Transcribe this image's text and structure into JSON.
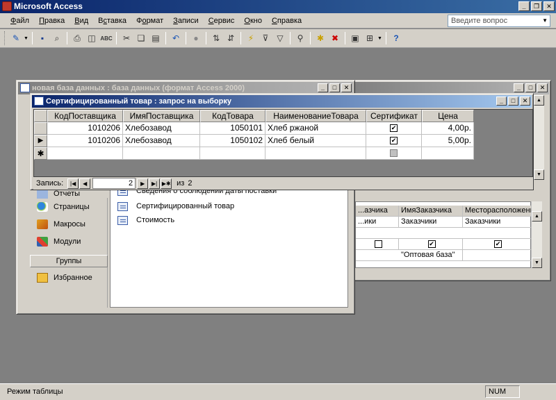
{
  "app": {
    "title": "Microsoft Access"
  },
  "menu": [
    {
      "label": "Файл",
      "acc": "Ф",
      "rest": "айл"
    },
    {
      "label": "Правка",
      "acc": "П",
      "rest": "равка"
    },
    {
      "label": "Вид",
      "acc": "В",
      "rest": "ид"
    },
    {
      "label": "Вставка",
      "acc": "с",
      "pre": "В",
      "rest": "тавка"
    },
    {
      "label": "Формат",
      "acc": "о",
      "pre": "Ф",
      "rest": "рмат"
    },
    {
      "label": "Записи",
      "acc": "З",
      "rest": "аписи"
    },
    {
      "label": "Сервис",
      "acc": "С",
      "rest": "ервис"
    },
    {
      "label": "Окно",
      "acc": "О",
      "rest": "кно"
    },
    {
      "label": "Справка",
      "acc": "С",
      "rest": "правка"
    }
  ],
  "help_box": {
    "placeholder": "Введите вопрос"
  },
  "db_window": {
    "title": "новая база данных : база данных (формат Access 2000)",
    "sidebar": {
      "pages": "Страницы",
      "macros": "Макросы",
      "modules": "Модули",
      "groups": "Группы",
      "favorites": "Избранное",
      "reports_partial": "Отчеты"
    },
    "list": {
      "partial": "Сведения о соблюдении даты поставки",
      "item1": "Сертифицированный товар",
      "item2": "Стоимость"
    }
  },
  "bg_table": {
    "headers": [
      "...азчика",
      "ИмяЗаказчика",
      "Месторасположение"
    ],
    "row1": [
      "...ики",
      "Заказчики",
      "Заказчики"
    ],
    "row4": [
      "",
      "\"Оптовая база\"",
      ""
    ]
  },
  "query_window": {
    "title": "Сертифицированный товар : запрос на выборку",
    "columns": [
      "КодПоставщика",
      "ИмяПоставщика",
      "КодТовара",
      "НаименованиеТовара",
      "Сертификат",
      "Цена"
    ],
    "rows": [
      {
        "supplier_code": "1010206",
        "supplier_name": "Хлебозавод",
        "product_code": "1050101",
        "product_name": "Хлеб ржаной",
        "certified": true,
        "price": "4,00р."
      },
      {
        "supplier_code": "1010206",
        "supplier_name": "Хлебозавод",
        "product_code": "1050102",
        "product_name": "Хлеб белый",
        "certified": true,
        "price": "5,00р."
      }
    ],
    "nav": {
      "label": "Запись:",
      "current": "2",
      "of_label": "из",
      "total": "2"
    }
  },
  "status": {
    "text": "Режим таблицы",
    "num": "NUM"
  }
}
